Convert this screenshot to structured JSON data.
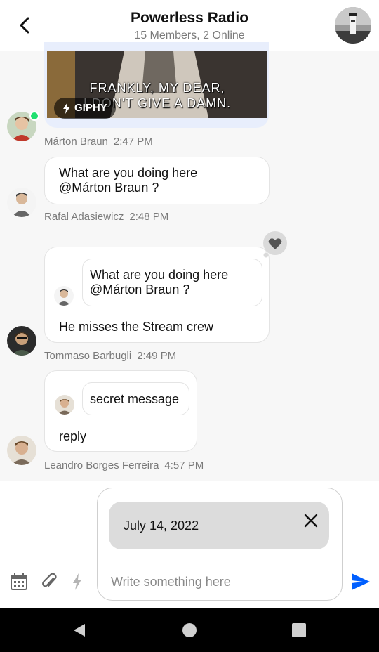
{
  "header": {
    "title": "Powerless Radio",
    "subtitle": "15 Members, 2 Online"
  },
  "giphy": {
    "caption_line1": "FRANKLY, MY DEAR,",
    "caption_line2": "I DON'T GIVE A DAMN.",
    "badge_label": "GIPHY"
  },
  "messages": [
    {
      "author": "Márton Braun",
      "time": "2:47 PM"
    },
    {
      "text_line1": "What are you doing here",
      "text_line2": "@Márton Braun ?",
      "author": "Rafal Adasiewicz",
      "time": "2:48 PM"
    },
    {
      "quote_line1": "What are you doing here",
      "quote_line2": "@Márton Braun ?",
      "text": "He misses the Stream crew",
      "author": "Tommaso Barbugli",
      "time": "2:49 PM"
    },
    {
      "quote": "secret message",
      "text": "reply",
      "author": "Leandro Borges Ferreira",
      "time": "4:57 PM"
    }
  ],
  "composer": {
    "attachment_chip": "July 14, 2022",
    "placeholder": "Write something here"
  },
  "icons": {
    "back": "back-arrow-icon",
    "close": "close-icon",
    "calendar": "calendar-icon",
    "attach": "paperclip-icon",
    "commands": "lightning-icon",
    "send": "send-icon",
    "reaction": "heart-icon"
  },
  "colors": {
    "accent": "#005FFF",
    "online": "#20E070",
    "disabled_icon": "#B4B4B4"
  }
}
